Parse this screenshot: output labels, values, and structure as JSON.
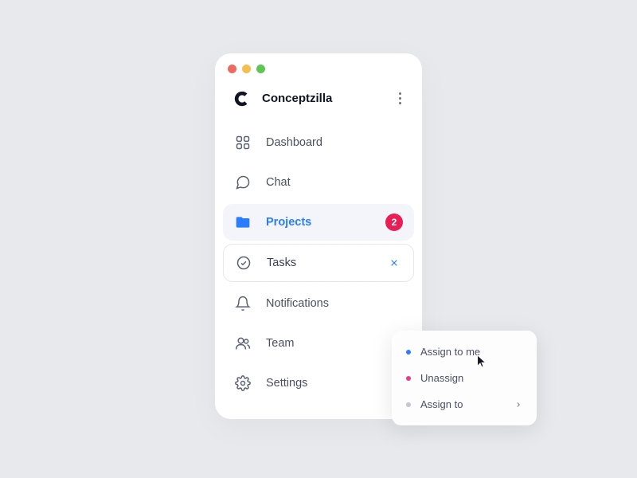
{
  "traffic": {
    "red": "#ec6a5e",
    "yellow": "#f4bf4f",
    "green": "#61c554"
  },
  "brand": {
    "name": "Conceptzilla"
  },
  "nav": {
    "dashboard": "Dashboard",
    "chat": "Chat",
    "projects": "Projects",
    "projects_badge": "2",
    "tasks": "Tasks",
    "notifications": "Notifications",
    "team": "Team",
    "settings": "Settings"
  },
  "menu": {
    "assign_me": "Assign to me",
    "unassign": "Unassign",
    "assign_to": "Assign to",
    "dot_blue": "#2a7dff",
    "dot_pink": "#e83a8c",
    "dot_gray": "#c2c6d1"
  }
}
